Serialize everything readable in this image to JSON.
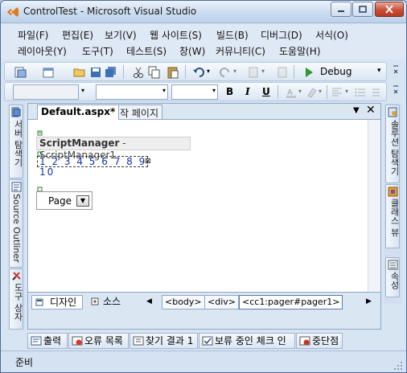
{
  "window": {
    "title": "ControlTest - Microsoft Visual Studio"
  },
  "menu": {
    "row1": [
      "파일(F)",
      "편집(E)",
      "보기(V)",
      "웹 사이트(S)",
      "빌드(B)",
      "디버그(D)",
      "서식(O)"
    ],
    "row2": [
      "레이아웃(Y)",
      "도구(T)",
      "테스트(S)",
      "창(W)",
      "커뮤니티(C)",
      "도움말(H)"
    ]
  },
  "toolbar": {
    "config_value": "Debug",
    "format_buttons": [
      "B",
      "I",
      "U"
    ]
  },
  "left_panel": {
    "tabs": [
      "서버 탐색기",
      "Source Outliner",
      "도구 상자"
    ]
  },
  "right_panel": {
    "tabs": [
      "솔루션 탐색기",
      "클래스 뷰",
      "속성"
    ]
  },
  "document": {
    "tabs": [
      {
        "label": "Default.aspx*",
        "active": true
      },
      {
        "label": "시작 페이지",
        "active": false
      }
    ],
    "script_manager": {
      "type": "ScriptManager",
      "name": " - ScriptManager1"
    },
    "pager_numbers": "1 2 3 4 5 6 7 8 9 10",
    "page_dropdown_label": "Page"
  },
  "view_bar": {
    "design_label": "디자인",
    "source_label": "소스",
    "breadcrumbs": [
      "<body>",
      "<div>",
      "<cc1:pager#pager1>"
    ]
  },
  "output_tabs": [
    "출력",
    "오류 목록",
    "찾기 결과 1",
    "보류 중인 체크 인",
    "중단점"
  ],
  "status": {
    "text": "준비"
  }
}
